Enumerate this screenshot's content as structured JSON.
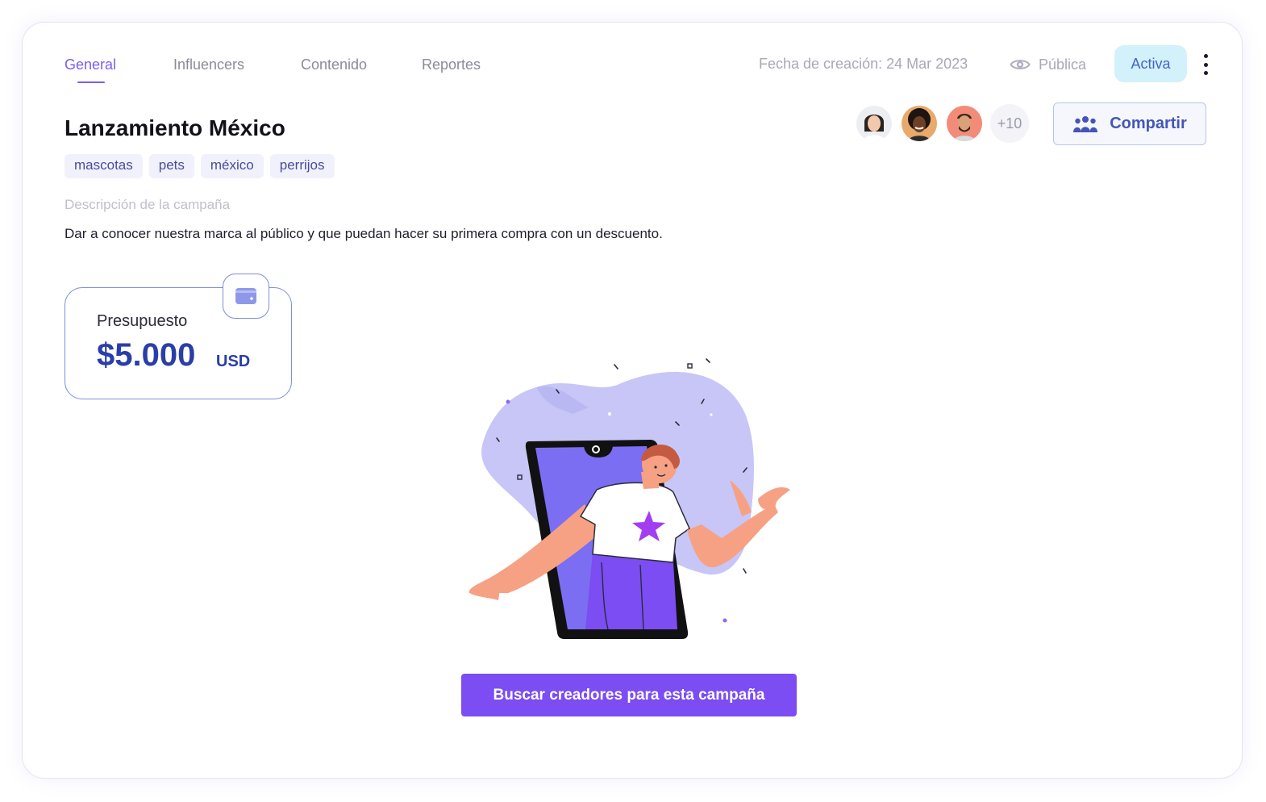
{
  "tabs": [
    {
      "label": "General",
      "active": true
    },
    {
      "label": "Influencers",
      "active": false
    },
    {
      "label": "Contenido",
      "active": false
    },
    {
      "label": "Reportes",
      "active": false
    }
  ],
  "header": {
    "created": "Fecha de creación: 24 Mar 2023",
    "visibility_label": "Pública",
    "visibility_icon": "eye-icon",
    "status_label": "Activa",
    "more_icon": "kebab-menu-icon"
  },
  "campaign": {
    "title": "Lanzamiento México",
    "tags": [
      "mascotas",
      "pets",
      "méxico",
      "perrijos"
    ],
    "description_label": "Descripción de la campaña",
    "description": "Dar a conocer nuestra marca al público y que puedan hacer su primera compra con un descuento."
  },
  "collaborators": {
    "more_count": "+10",
    "share_label": "Compartir",
    "share_icon": "group-icon"
  },
  "budget": {
    "label": "Presupuesto",
    "amount": "$5.000",
    "currency": "USD",
    "icon": "wallet-icon"
  },
  "cta": {
    "label": "Buscar creadores para esta campaña"
  },
  "colors": {
    "accent": "#7b4df2",
    "tab_active": "#7b5cf0",
    "budget_text": "#2a3ea8",
    "status_bg": "#d3f1fb"
  }
}
